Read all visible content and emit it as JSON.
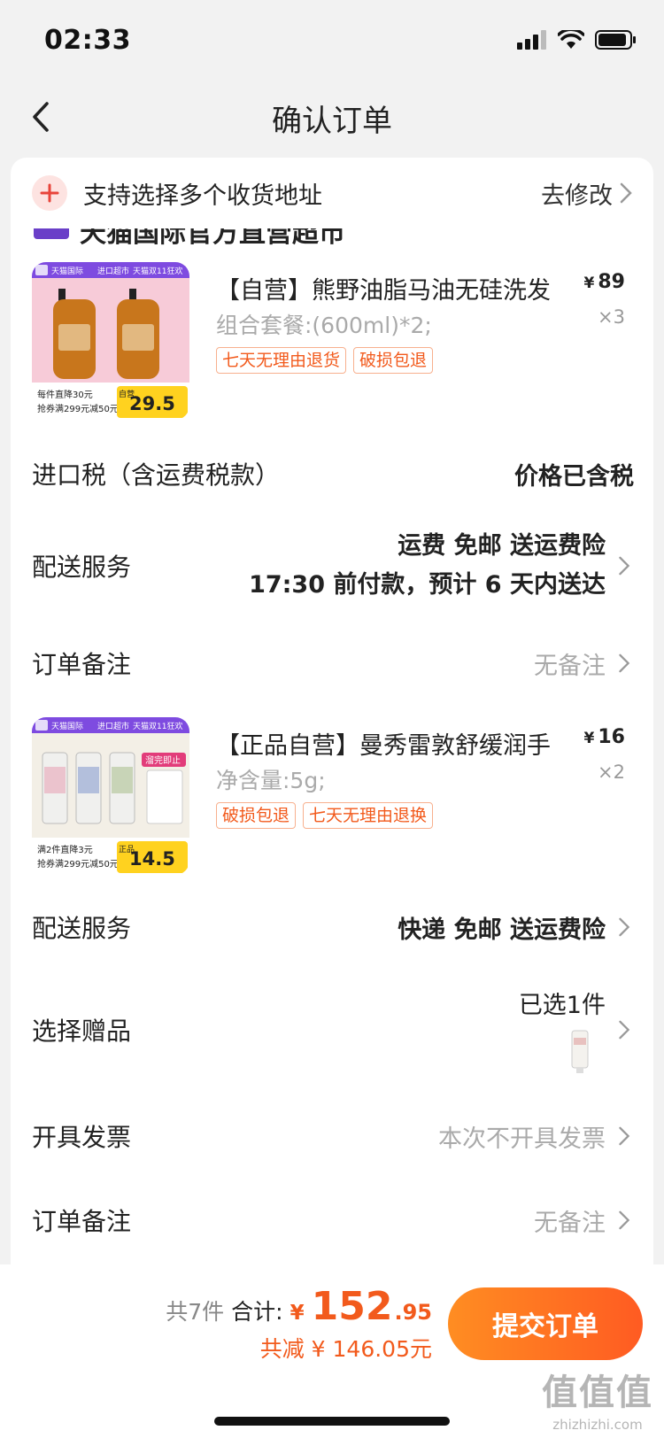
{
  "status_bar": {
    "time": "02:33"
  },
  "nav": {
    "title": "确认订单"
  },
  "address_banner": {
    "text": "支持选择多个收货地址",
    "action": "去修改"
  },
  "store_peek": {
    "text": "天猫国际官方直营超市"
  },
  "products": [
    {
      "title": "【自营】熊野油脂马油无硅洗发",
      "price_currency": "¥",
      "price": "89",
      "qty": "×3",
      "spec": "组合套餐:(600ml)*2;",
      "tags": [
        "七天无理由退货",
        "破损包退"
      ],
      "thumb": {
        "top_labels": [
          "天猫国际",
          "进口超市",
          "天猫双11狂欢"
        ],
        "promo1": "每件直降30元",
        "promo2": "抢券满299元减50元",
        "price": "29.5",
        "side": "自营",
        "color_accent": "#c8761c"
      }
    },
    {
      "title": "【正品自营】曼秀雷敦舒缓润手",
      "price_currency": "¥",
      "price": "16",
      "qty": "×2",
      "spec": "净含量:5g;",
      "tags": [
        "破损包退",
        "七天无理由退换"
      ],
      "thumb": {
        "top_labels": [
          "天猫国际",
          "进口超市",
          "天猫双11狂欢"
        ],
        "promo1": "满2件直降3元",
        "promo2": "抢券满299元减50元",
        "price": "14.5",
        "side": "正品",
        "badge": "溜完即止",
        "color_accent": "#b7c7a0"
      }
    }
  ],
  "rows": {
    "tax": {
      "label": "进口税（含运费税款）",
      "value": "价格已含税"
    },
    "delivery1": {
      "label": "配送服务",
      "line1": "运费 免邮 送运费险",
      "line2": "17:30 前付款，预计 6 天内送达"
    },
    "remark1": {
      "label": "订单备注",
      "value": "无备注"
    },
    "delivery2": {
      "label": "配送服务",
      "value": "快递 免邮 送运费险"
    },
    "gift": {
      "label": "选择赠品",
      "value": "已选1件"
    },
    "invoice": {
      "label": "开具发票",
      "value": "本次不开具发票"
    },
    "remark2": {
      "label": "订单备注",
      "value": "无备注"
    }
  },
  "bottom": {
    "count": "共7件",
    "total_label": "合计:",
    "currency": "¥",
    "amount_int": "152",
    "amount_dec": ".95",
    "discount": "共减 ¥ 146.05元",
    "submit": "提交订单"
  },
  "watermark": {
    "main": "值值值",
    "url": "zhizhizhi.com"
  },
  "colors": {
    "accent": "#f25a1c",
    "button_start": "#ff8d22",
    "button_end": "#ff5b22"
  }
}
